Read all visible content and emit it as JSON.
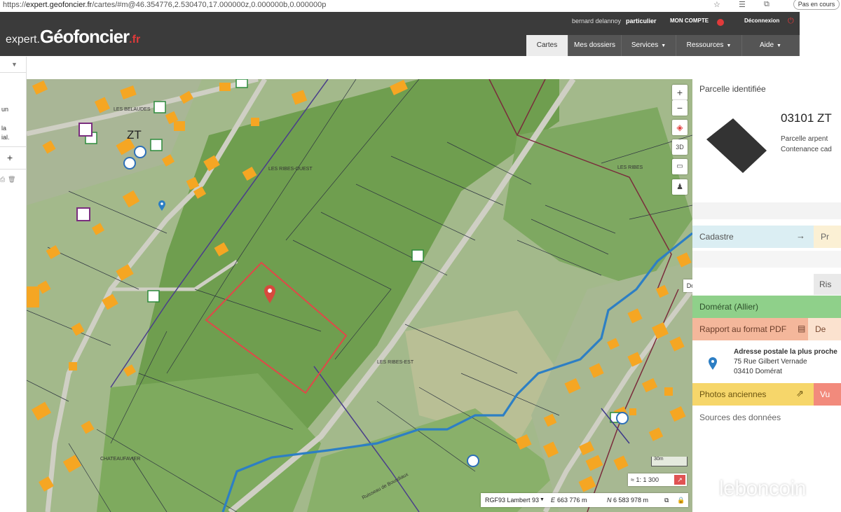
{
  "browser": {
    "url_prefix": "https://",
    "url_domain": "expert.geofoncier.fr",
    "url_rest": "/cartes/#m@46.354776,2.530470,17.000000z,0.000000b,0.000000p",
    "paused_label": "Pas en cours"
  },
  "header": {
    "logo_prefix": "expert.",
    "logo_brand": "Géofoncier",
    "logo_tld": ".fr",
    "user_name": "bernard delannoy",
    "user_type": "particulier",
    "account_label": "MON COMPTE",
    "logout_label": "Déconnexion",
    "tabs": [
      {
        "label": "Cartes",
        "caret": false
      },
      {
        "label": "Mes dossiers",
        "caret": false
      },
      {
        "label": "Services",
        "caret": true
      },
      {
        "label": "Ressources",
        "caret": true
      },
      {
        "label": "Aide",
        "caret": true
      }
    ]
  },
  "left_panel": {
    "text_1": "un",
    "text_2": "la",
    "text_3": "ial."
  },
  "map": {
    "place_labels": [
      "LES BELAUDES",
      "LES RIBES-OUEST",
      "LES RIBES",
      "LES RIBES-EST",
      "CHATEAUFAVIER"
    ],
    "section_label": "ZT",
    "river_label": "Ruisseau de Bousdiaux",
    "town_tooltip": "Domérat",
    "zoom_in": "+",
    "zoom_out": "−",
    "scale_label": "30m",
    "scale_value": "1 300",
    "scale_prefix": "≈ 1:",
    "projection": "RGF93 Lambert 93",
    "easting_label": "E",
    "easting_value": "663 776 m",
    "northing_label": "N",
    "northing_value": "6 583 978 m"
  },
  "right_panel": {
    "title": "Parcelle identifiée",
    "parcel_id": "03101 ZT",
    "parcel_line1": "Parcelle arpent",
    "parcel_line2": "Contenance cad",
    "cadastre_label": "Cadastre",
    "cadastre_side": "Pr",
    "risk_label": "Ris",
    "commune_label": "Domérat (Allier)",
    "report_label": "Rapport au format PDF",
    "report_side": "De",
    "address_title": "Adresse postale la plus proche",
    "address_street": "75 Rue Gilbert Vernade",
    "address_city": "03410 Domérat",
    "photos_label": "Photos anciennes",
    "photos_side": "Vu",
    "sources_label": "Sources des données"
  },
  "watermark": "leboncoin",
  "colors": {
    "header_dark": "#3b3b3b",
    "accent_red": "#e03a3a",
    "cadastre_bg": "#dbeef3",
    "commune_green": "#8fd08a",
    "report_orange": "#f4b79b",
    "photos_yellow": "#f6d66a",
    "parcel_outline": "#e04848",
    "river_blue": "#2d7fc4"
  }
}
